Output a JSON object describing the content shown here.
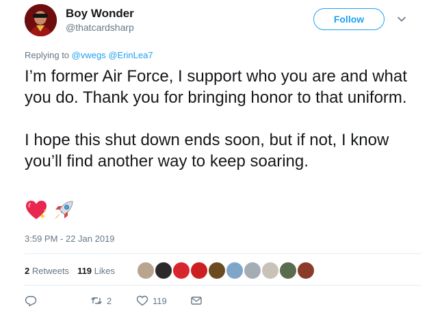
{
  "tweet": {
    "author": {
      "name": "Boy Wonder",
      "handle": "@thatcardsharp"
    },
    "follow_label": "Follow",
    "replying_prefix": "Replying to ",
    "replying_to": [
      "@vwegs",
      "@ErinLea7"
    ],
    "text_paragraphs": [
      "I’m former Air Force, I support who you are and what you do. Thank you for bringing honor to that uniform.",
      "I hope this shut down ends soon, but if not, I know you’ll find another way to keep soaring."
    ],
    "emojis": [
      "sparkling-heart-icon",
      "rocket-icon"
    ],
    "timestamp": "3:59 PM - 22 Jan 2019",
    "stats": {
      "retweets_count": "2",
      "retweets_label": "Retweets",
      "likes_count": "119",
      "likes_label": "Likes"
    },
    "liker_avatars": [
      "#b9a48f",
      "#2a2a2a",
      "#d8262e",
      "#cc1f1f",
      "#6b4a22",
      "#7fa6c9",
      "#a5adb4",
      "#c9c2b8",
      "#5a6b4e",
      "#8b3b2a"
    ],
    "actions": {
      "reply_count": "",
      "retweet_count": "2",
      "like_count": "119"
    }
  },
  "colors": {
    "accent": "#1da1f2",
    "text": "#14171a",
    "muted": "#657786",
    "divider": "#e6ecf0"
  }
}
